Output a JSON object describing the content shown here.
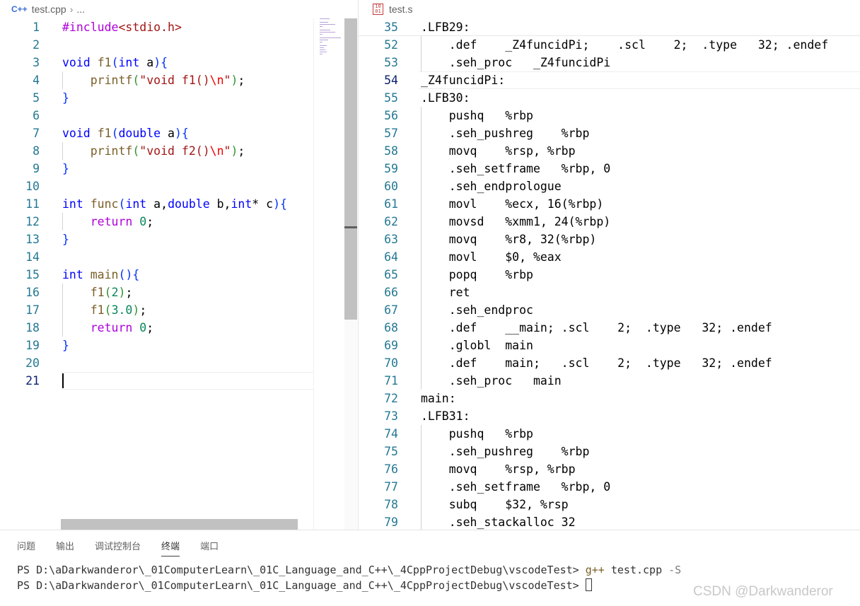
{
  "left_editor": {
    "breadcrumb": {
      "file": "test.cpp",
      "more": "..."
    },
    "active_line": "21"
  },
  "right_editor": {
    "breadcrumb": {
      "file": "test.s"
    },
    "icon_glyph": "10\n01"
  },
  "panel": {
    "tabs": [
      "问题",
      "输出",
      "调试控制台",
      "终端",
      "端口"
    ],
    "active_tab": "终端",
    "terminal": {
      "prompt": "PS D:\\aDarkwanderor\\_01ComputerLearn\\_01C_Language_and_C++\\_4CppProjectDebug\\vscodeTest>",
      "cmd": "g++",
      "arg": "test.cpp",
      "flag": "-S"
    }
  },
  "watermark": "CSDN @Darkwanderor",
  "colors": {
    "line_number": "#237893",
    "keyword": "#0000ff",
    "string": "#a31515",
    "number": "#098658",
    "function": "#795e26"
  }
}
